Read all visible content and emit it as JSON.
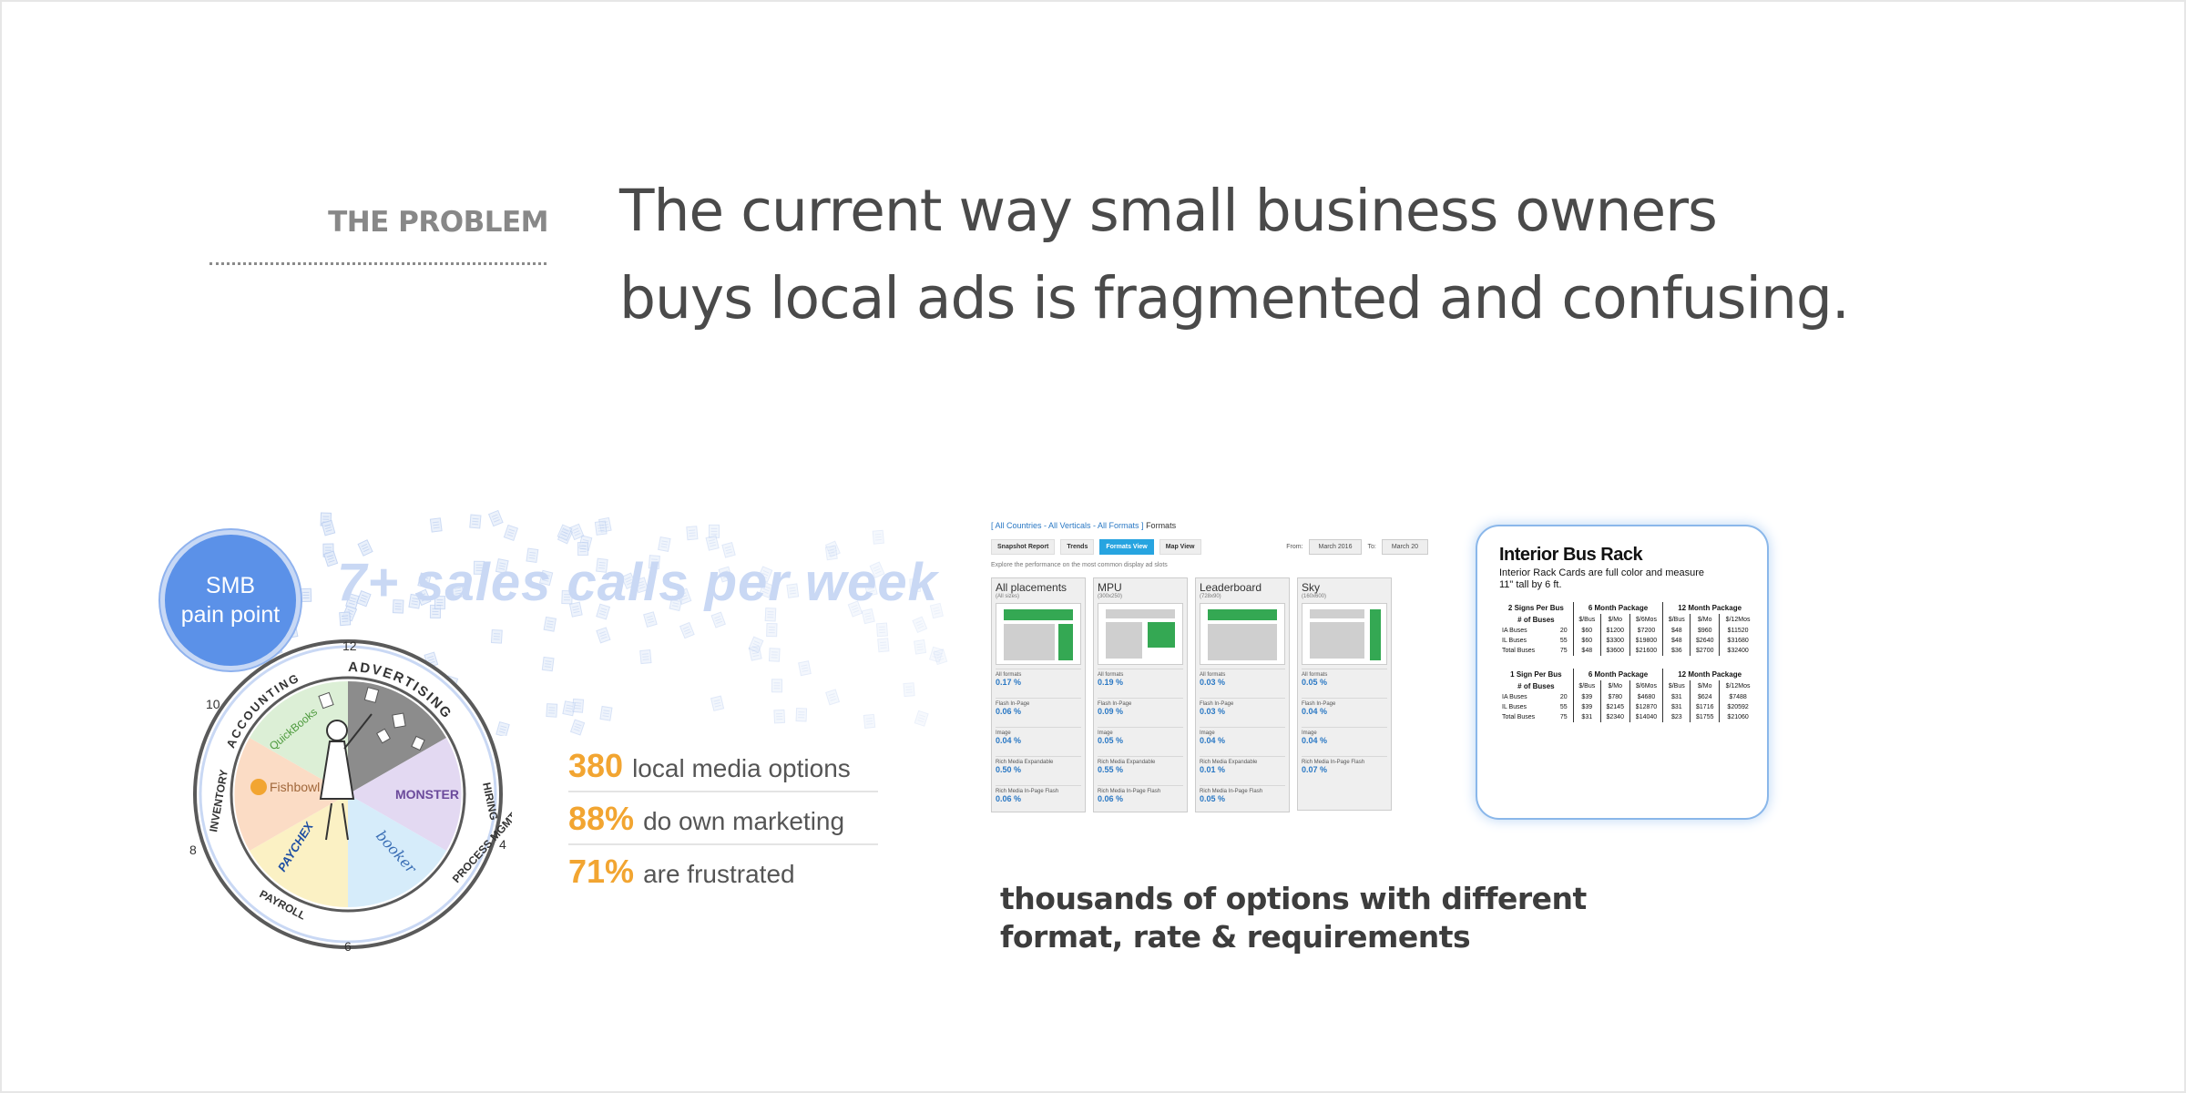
{
  "slide": {
    "section_label": "THE PROBLEM",
    "headline_line1": "The current way small business owners",
    "headline_line2": "buys local ads is fragmented and confusing."
  },
  "smb": {
    "bubble_line1": "SMB",
    "bubble_line2": "pain point",
    "calls": "7+ sales calls per week",
    "wheel": {
      "segments": [
        "ACCOUNTING",
        "ADVERTISING",
        "HIRING",
        "PROCESS MGMT.",
        "PAYROLL",
        "INVENTORY"
      ],
      "clock": [
        "12",
        "4",
        "6",
        "8",
        "10"
      ],
      "brands": [
        "QuickBooks",
        "Fishbowl",
        "MONSTER",
        "booker",
        "PAYCHEX"
      ]
    }
  },
  "stats": [
    {
      "num": "380",
      "text": "local media options"
    },
    {
      "num": "88%",
      "text": "do own marketing"
    },
    {
      "num": "71%",
      "text": "are frustrated"
    }
  ],
  "ad_panel": {
    "breadcrumb_links": "[ All Countries - All Verticals - All Formats ]",
    "breadcrumb_tail": " Formats",
    "tabs": [
      "Snapshot Report",
      "Trends",
      "Formats View",
      "Map View"
    ],
    "from_label": "From:",
    "from_value": "March 2016",
    "to_label": "To:",
    "to_value": "March 20",
    "note": "Explore the performance on the most common display ad slots",
    "cards": [
      {
        "title": "All placements",
        "sub": "(All sizes)",
        "metrics": [
          {
            "label": "All formats",
            "value": "0.17 %"
          },
          {
            "label": "Flash In-Page",
            "value": "0.06 %"
          },
          {
            "label": "Image",
            "value": "0.04 %"
          },
          {
            "label": "Rich Media Expandable",
            "value": "0.50 %"
          },
          {
            "label": "Rich Media In-Page Flash",
            "value": "0.06 %"
          }
        ]
      },
      {
        "title": "MPU",
        "sub": "(300x250)",
        "metrics": [
          {
            "label": "All formats",
            "value": "0.19 %"
          },
          {
            "label": "Flash In-Page",
            "value": "0.09 %"
          },
          {
            "label": "Image",
            "value": "0.05 %"
          },
          {
            "label": "Rich Media Expandable",
            "value": "0.55 %"
          },
          {
            "label": "Rich Media In-Page Flash",
            "value": "0.06 %"
          }
        ]
      },
      {
        "title": "Leaderboard",
        "sub": "(728x90)",
        "metrics": [
          {
            "label": "All formats",
            "value": "0.03 %"
          },
          {
            "label": "Flash In-Page",
            "value": "0.03 %"
          },
          {
            "label": "Image",
            "value": "0.04 %"
          },
          {
            "label": "Rich Media Expandable",
            "value": "0.01 %"
          },
          {
            "label": "Rich Media In-Page Flash",
            "value": "0.05 %"
          }
        ]
      },
      {
        "title": "Sky",
        "sub": "(160x600)",
        "metrics": [
          {
            "label": "All formats",
            "value": "0.05 %"
          },
          {
            "label": "Flash In-Page",
            "value": "0.04 %"
          },
          {
            "label": "Image",
            "value": "0.04 %"
          },
          {
            "label": "Rich Media In-Page Flash",
            "value": "0.07 %"
          }
        ]
      }
    ]
  },
  "bus_rack": {
    "title": "Interior Bus Rack",
    "desc_line1": "Interior Rack Cards are full color and measure",
    "desc_line2": "11\" tall by 6 ft.",
    "table1": {
      "col_head": "2 Signs Per Bus",
      "col_sub": "# of Buses",
      "pkg6": "6 Month Package",
      "pkg12": "12 Month Package",
      "sub_heads": [
        "$/Bus",
        "$/Mo",
        "$/6Mos",
        "$/Bus",
        "$/Mo",
        "$/12Mos"
      ],
      "rows": [
        [
          "IA Buses",
          "20",
          "$60",
          "$1200",
          "$7200",
          "$48",
          "$960",
          "$11520"
        ],
        [
          "IL Buses",
          "55",
          "$60",
          "$3300",
          "$19800",
          "$48",
          "$2640",
          "$31680"
        ],
        [
          "Total Buses",
          "75",
          "$48",
          "$3600",
          "$21600",
          "$36",
          "$2700",
          "$32400"
        ]
      ]
    },
    "table2": {
      "col_head": "1 Sign Per Bus",
      "col_sub": "# of Buses",
      "pkg6": "6 Month Package",
      "pkg12": "12 Month Package",
      "sub_heads": [
        "$/Bus",
        "$/Mo",
        "$/6Mos",
        "$/Bus",
        "$/Mo",
        "$/12Mos"
      ],
      "rows": [
        [
          "IA Buses",
          "20",
          "$39",
          "$780",
          "$4680",
          "$31",
          "$624",
          "$7488"
        ],
        [
          "IL Buses",
          "55",
          "$39",
          "$2145",
          "$12870",
          "$31",
          "$1716",
          "$20592"
        ],
        [
          "Total Buses",
          "75",
          "$31",
          "$2340",
          "$14040",
          "$23",
          "$1755",
          "$21060"
        ]
      ]
    }
  },
  "caption_line1": "thousands of options with different",
  "caption_line2": "format, rate & requirements",
  "colors": {
    "accent_orange": "#f2a531",
    "bubble_blue": "#5b91e8",
    "link_blue": "#2a78c4",
    "tab_active": "#27a4e0",
    "ad_green": "#34a853"
  },
  "icons": {
    "doc_field": "floating-document-icons"
  }
}
